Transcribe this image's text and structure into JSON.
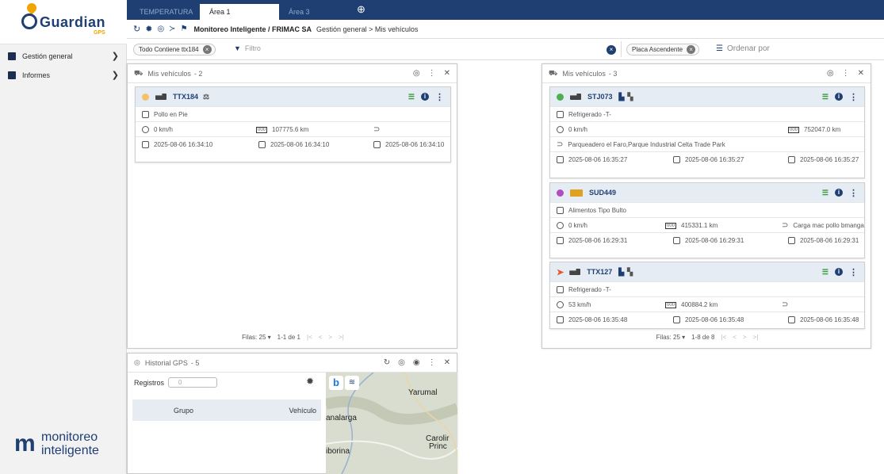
{
  "brand": {
    "logo_text": "Guardian",
    "logo_sub": "GPS",
    "footer_line1": "monitoreo",
    "footer_line2": "inteligente",
    "footer_mark": "m"
  },
  "sidebar": {
    "items": [
      {
        "label": "Gestión general"
      },
      {
        "label": "Informes"
      }
    ]
  },
  "tabs": [
    {
      "label": "TEMPERATURA"
    },
    {
      "label": "Área 1"
    },
    {
      "label": "Área 3"
    }
  ],
  "tab_add": "⊕",
  "breadcrumb": {
    "company": "Monitoreo Inteligente / FRIMAC SA",
    "path": "Gestión general > Mis vehículos"
  },
  "filters": {
    "chip": "Todo Contiene ttx184",
    "filter_label": "Filtro",
    "sort_chip": "Placa Ascendente",
    "order_label": "Ordenar por"
  },
  "panel_left": {
    "title": "Mis vehículos",
    "count": "- 2",
    "footer_rows": "Filas: 25 ▾",
    "footer_range": "1-1 de 1",
    "vehicles": [
      {
        "plate": "TTX184",
        "cargo": "Pollo en Pie",
        "speed": "0 km/h",
        "odometer": "107775.6 km",
        "location": "",
        "date1": "2025-08-06 16:34:10",
        "date2": "2025-08-06 16:34:10",
        "date3": "2025-08-06 16:34:10",
        "status_color": "#f5c26b"
      }
    ]
  },
  "panel_right": {
    "title": "Mis vehículos",
    "count": "- 3",
    "footer_rows": "Filas: 25 ▾",
    "footer_range": "1-8 de 8",
    "vehicles": [
      {
        "plate": "STJ073",
        "cargo": "Refrigerado -T-",
        "speed": "0 km/h",
        "odometer": "752047.0 km",
        "location": "Parqueadero el Faro,Parque Industrial Celta Trade Park",
        "date1": "2025-08-06 16:35:27",
        "date2": "2025-08-06 16:35:27",
        "date3": "2025-08-06 16:35:27",
        "status_color": "#4caf50"
      },
      {
        "plate": "SUD449",
        "cargo": "Alimentos Tipo Bulto",
        "speed": "0 km/h",
        "odometer": "415331.1 km",
        "location": "Carga mac pollo bmanga",
        "date1": "2025-08-06 16:29:31",
        "date2": "2025-08-06 16:29:31",
        "date3": "2025-08-06 16:29:31",
        "status_color": "#b04ec0"
      },
      {
        "plate": "TTX127",
        "cargo": "Refrigerado -T-",
        "speed": "53 km/h",
        "odometer": "400884.2 km",
        "location": "",
        "date1": "2025-08-06 16:35:48",
        "date2": "2025-08-06 16:35:48",
        "date3": "2025-08-06 16:35:48",
        "status_color": "#e8562e"
      }
    ]
  },
  "history": {
    "title": "Historial GPS",
    "count": "- 5",
    "registros_label": "Registros",
    "registros_value": "0",
    "col_group": "Grupo",
    "col_vehicle": "Vehículo"
  },
  "map": {
    "labels": [
      "Yarumal",
      "analarga",
      "Carolir",
      "Princ",
      "iborina"
    ]
  },
  "colors": {
    "navy": "#1f3f73",
    "accent": "#f0a500"
  }
}
